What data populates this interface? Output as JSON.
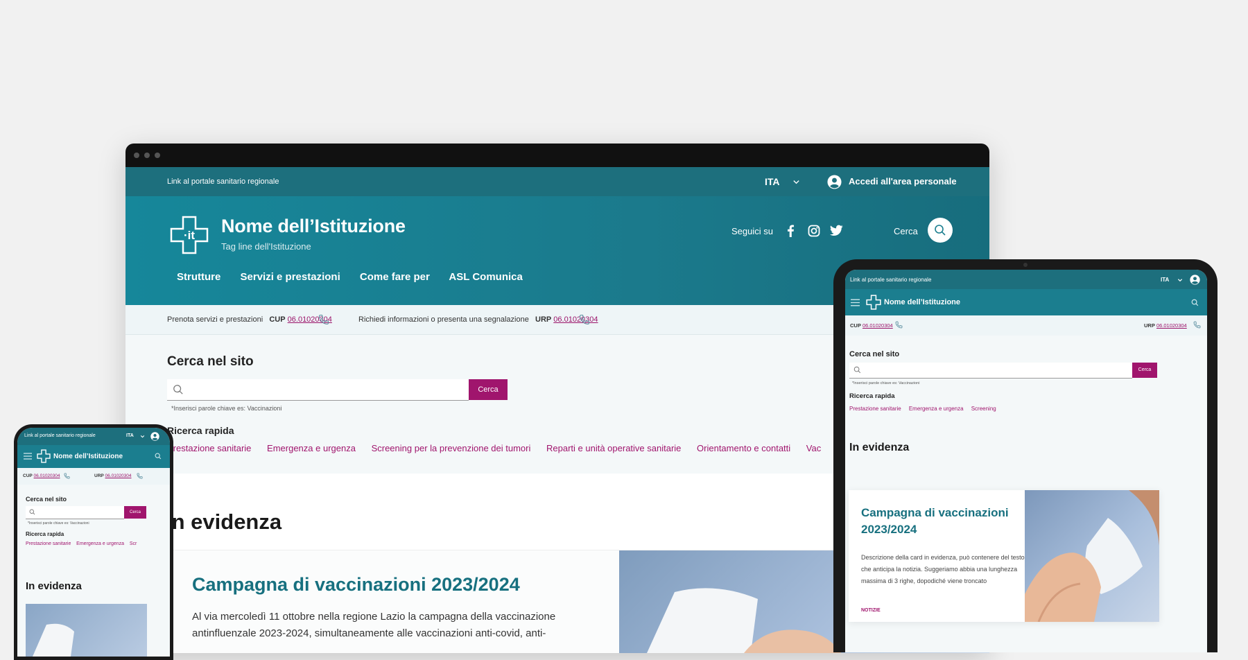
{
  "desktop": {
    "slim_header": {
      "link": "Link al portale sanitario regionale",
      "language": "ITA",
      "login": "Accedi all'area personale"
    },
    "header": {
      "name": "Nome dell’Istituzione",
      "tagline": "Tag line dell'Istituzione",
      "follow": "Seguici su",
      "search_label": "Cerca"
    },
    "nav": [
      "Strutture",
      "Servizi e prestazioni",
      "Come fare per",
      "ASL Comunica"
    ],
    "contacts": {
      "book_text": "Prenota servizi e prestazioni",
      "cup_label": "CUP",
      "cup_number": "06.01020304",
      "info_text": "Richiedi informazioni o presenta una segnalazione",
      "urp_label": "URP",
      "urp_number": "06.01020304"
    },
    "search": {
      "title": "Cerca nel sito",
      "button": "Cerca",
      "hint": "*Inserisci parole chiave es: Vaccinazioni"
    },
    "quick": {
      "title": "Ricerca rapida",
      "items": [
        "Prestazione sanitarie",
        "Emergenza e urgenza",
        "Screening per la prevenzione dei tumori",
        "Reparti e unità operative sanitarie",
        "Orientamento e contatti",
        "Vac"
      ]
    },
    "evidenza": {
      "title": "In evidenza",
      "card_title": "Campagna di vaccinazioni 2023/2024",
      "card_text": "Al via mercoledì 11 ottobre nella regione Lazio la campagna della vaccinazione antinfluenzale 2023-2024, simultaneamente alle vaccinazioni anti-covid, anti-"
    }
  },
  "tablet": {
    "slim_link": "Link al portale sanitario regionale",
    "language": "ITA",
    "name": "Nome dell’Istituzione",
    "cup_label": "CUP",
    "cup_number": "06.01020304",
    "urp_label": "URP",
    "urp_number": "06.01020304",
    "search_title": "Cerca nel sito",
    "search_button": "Cerca",
    "search_hint": "*Inserisci parole chiave es: Vaccinazioni",
    "quick_title": "Ricerca rapida",
    "quick_items": [
      "Prestazione sanitarie",
      "Emergenza e urgenza",
      "Screening"
    ],
    "evidenza_title": "In evidenza",
    "card_title_1": "Campagna di vaccinazioni",
    "card_title_2": "2023/2024",
    "card_text": "Descrizione della card in evidenza, può contenere del testo che anticipa la notizia. Suggeriamo abbia una lunghezza massima di 3 righe, dopodiché viene troncato",
    "card_category": "NOTIZIE"
  },
  "phone": {
    "slim_link": "Link al portale sanitario regionale",
    "language": "ITA",
    "name": "Nome dell’Istituzione",
    "cup_label": "CUP",
    "cup_number": "06.01020304",
    "urp_label": "URP",
    "urp_number": "06.01020304",
    "search_title": "Cerca nel sito",
    "search_button": "Cerca",
    "search_hint": "*Inserisci parole chiave es: Vaccinazioni",
    "quick_title": "Ricerca rapida",
    "quick_items": [
      "Prestazione sanitarie",
      "Emergenza e urgenza",
      "Scr"
    ],
    "evidenza_title": "In evidenza"
  },
  "colors": {
    "primary": "#1b7e8f",
    "slim": "#1d6f7d",
    "accent": "#a0156d",
    "card_title": "#17707f"
  },
  "icons": [
    "user-icon",
    "chevron-down-icon",
    "facebook-icon",
    "instagram-icon",
    "twitter-icon",
    "search-icon",
    "phone-icon",
    "hamburger-icon",
    "logo-cross-icon"
  ]
}
